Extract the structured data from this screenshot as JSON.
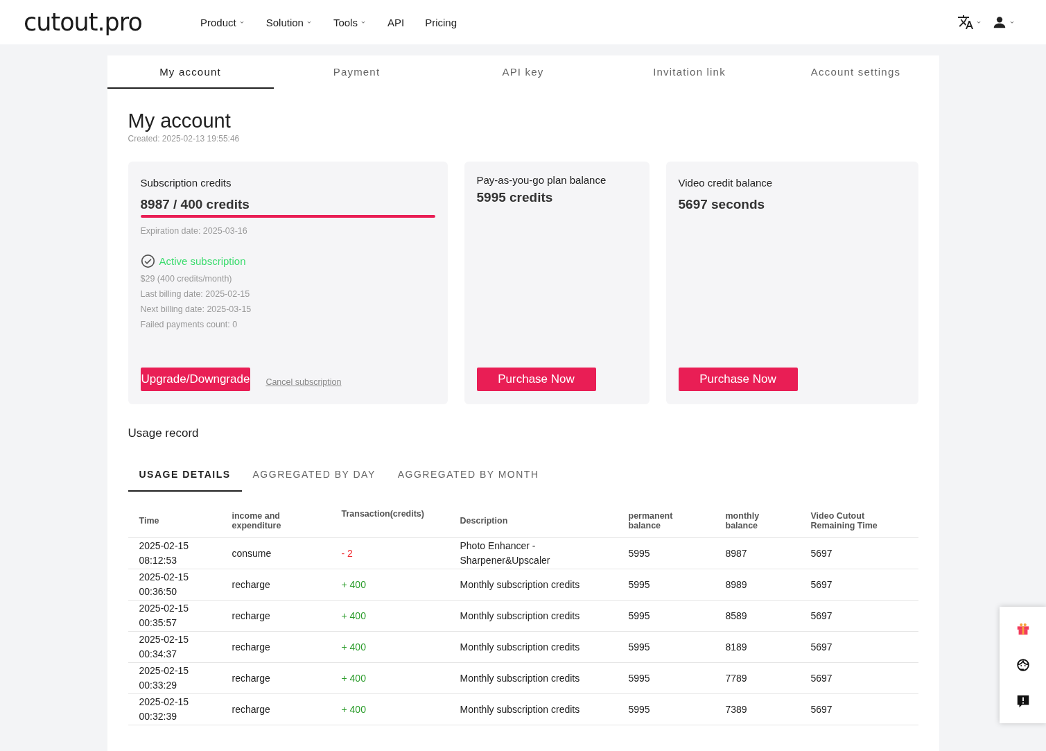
{
  "header": {
    "logo": "cutout.pro",
    "nav": [
      {
        "label": "Product",
        "dropdown": true
      },
      {
        "label": "Solution",
        "dropdown": true
      },
      {
        "label": "Tools",
        "dropdown": true
      },
      {
        "label": "API",
        "dropdown": false
      },
      {
        "label": "Pricing",
        "dropdown": false
      }
    ]
  },
  "tabs": [
    {
      "label": "My account",
      "selected": true
    },
    {
      "label": "Payment",
      "selected": false
    },
    {
      "label": "API key",
      "selected": false
    },
    {
      "label": "Invitation link",
      "selected": false
    },
    {
      "label": "Account settings",
      "selected": false
    }
  ],
  "title": "My account",
  "created": "Created: 2025-02-13 19:55:46",
  "subscription_card": {
    "label": "Subscription credits",
    "amount": "8987 / 400 credits",
    "level": 1,
    "expiration": "Expiration date: 2025-03-16",
    "status": "Active subscription",
    "active": true,
    "details": [
      "$29 (400 credits/month)",
      "Last billing date: 2025-02-15",
      "Next billing date: 2025-03-15",
      "Failed payments count: 0"
    ],
    "button": "Upgrade/Downgrade",
    "link": "Cancel subscription"
  },
  "balance_cards": [
    {
      "label": "Pay-as-you-go plan balance",
      "amount": "5995 credits",
      "button": "Purchase Now"
    },
    {
      "label": "Video credit balance",
      "amount": "5697 seconds",
      "button": "Purchase Now"
    }
  ],
  "usage_title": "Usage record",
  "usage_tabs": [
    {
      "label": "USAGE DETAILS",
      "selected": true
    },
    {
      "label": "AGGREGATED BY DAY",
      "selected": false
    },
    {
      "label": "AGGREGATED BY MONTH",
      "selected": false
    }
  ],
  "table": {
    "columns": [
      "Time",
      "income and expenditure",
      "Transaction(credits)",
      "Description",
      "permanent balance",
      "monthly balance",
      "Video Cutout Remaining Time"
    ],
    "rows": [
      {
        "kind": "debit",
        "cells": [
          "2025-02-15 08:12:53",
          "consume",
          "- 2",
          "Photo Enhancer - Sharpener&Upscaler",
          "5995",
          "8987",
          "5697"
        ]
      },
      {
        "kind": "credit",
        "cells": [
          "2025-02-15 00:36:50",
          "recharge",
          "+ 400",
          "Monthly subscription credits",
          "5995",
          "8989",
          "5697"
        ]
      },
      {
        "kind": "credit",
        "cells": [
          "2025-02-15 00:35:57",
          "recharge",
          "+ 400",
          "Monthly subscription credits",
          "5995",
          "8589",
          "5697"
        ]
      },
      {
        "kind": "credit",
        "cells": [
          "2025-02-15 00:34:37",
          "recharge",
          "+ 400",
          "Monthly subscription credits",
          "5995",
          "8189",
          "5697"
        ]
      },
      {
        "kind": "credit",
        "cells": [
          "2025-02-15 00:33:29",
          "recharge",
          "+ 400",
          "Monthly subscription credits",
          "5995",
          "7789",
          "5697"
        ]
      },
      {
        "kind": "credit",
        "cells": [
          "2025-02-15 00:32:39",
          "recharge",
          "+ 400",
          "Monthly subscription credits",
          "5995",
          "7389",
          "5697"
        ]
      }
    ]
  }
}
